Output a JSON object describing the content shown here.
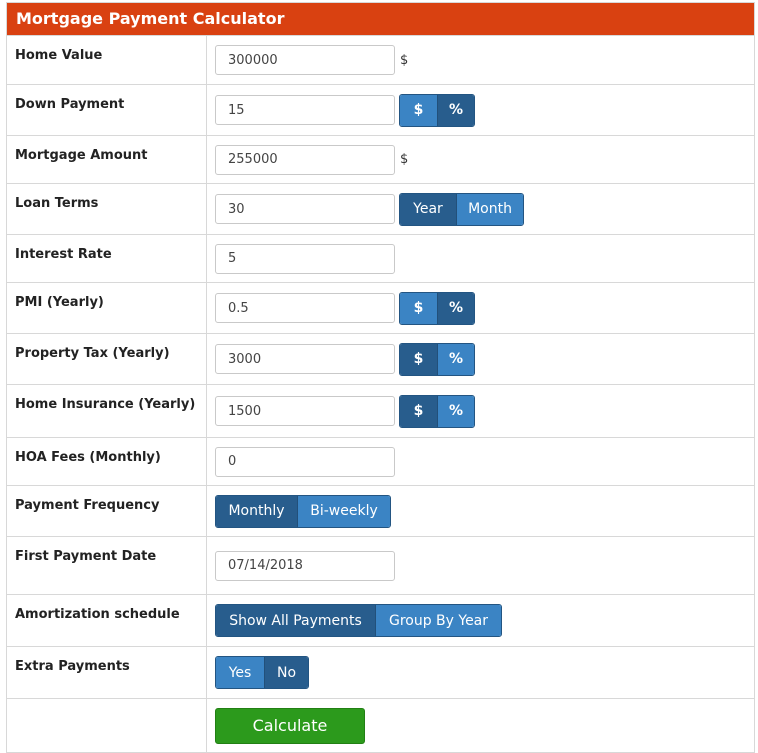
{
  "title": "Mortgage Payment Calculator",
  "fields": {
    "home_value": {
      "label": "Home Value",
      "value": "300000",
      "unit": "$"
    },
    "down_payment": {
      "label": "Down Payment",
      "value": "15",
      "options": [
        "$",
        "%"
      ],
      "selected": "%"
    },
    "mortgage_amount": {
      "label": "Mortgage Amount",
      "value": "255000",
      "unit": "$"
    },
    "loan_terms": {
      "label": "Loan Terms",
      "value": "30",
      "options": [
        "Year",
        "Month"
      ],
      "selected": "Year"
    },
    "interest_rate": {
      "label": "Interest Rate",
      "value": "5"
    },
    "pmi": {
      "label": "PMI (Yearly)",
      "value": "0.5",
      "options": [
        "$",
        "%"
      ],
      "selected": "%"
    },
    "property_tax": {
      "label": "Property Tax (Yearly)",
      "value": "3000",
      "options": [
        "$",
        "%"
      ],
      "selected": "$"
    },
    "home_insurance": {
      "label": "Home Insurance (Yearly)",
      "value": "1500",
      "options": [
        "$",
        "%"
      ],
      "selected": "$"
    },
    "hoa_fees": {
      "label": "HOA Fees (Monthly)",
      "value": "0"
    },
    "payment_frequency": {
      "label": "Payment Frequency",
      "options": [
        "Monthly",
        "Bi-weekly"
      ],
      "selected": "Monthly"
    },
    "first_payment_date": {
      "label": "First Payment Date",
      "value": "07/14/2018"
    },
    "amortization_schedule": {
      "label": "Amortization schedule",
      "options": [
        "Show All Payments",
        "Group By Year"
      ],
      "selected": "Show All Payments"
    },
    "extra_payments": {
      "label": "Extra Payments",
      "options": [
        "Yes",
        "No"
      ],
      "selected": "No"
    }
  },
  "calculate_label": "Calculate",
  "colors": {
    "header": "#d94111",
    "selected": "#285d8d",
    "unselected": "#3b84c4",
    "calculate": "#2c9a1c"
  }
}
